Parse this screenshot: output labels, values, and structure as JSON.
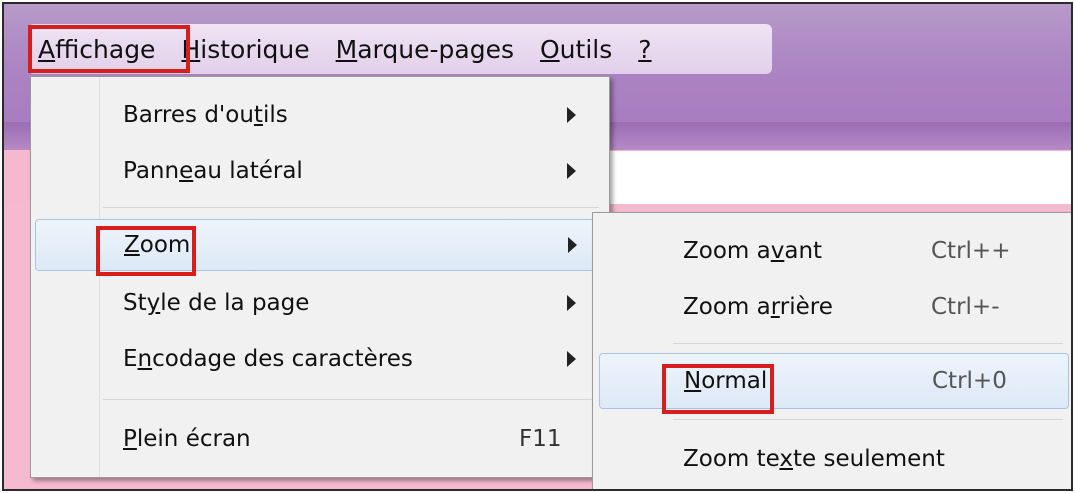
{
  "menubar": {
    "items": [
      {
        "accel": "A",
        "rest": "ffichage"
      },
      {
        "accel": "H",
        "rest": "istorique"
      },
      {
        "accel": "M",
        "rest": "arque-pages"
      },
      {
        "accel": "O",
        "rest": "utils"
      },
      {
        "accel": "?",
        "rest": ""
      }
    ]
  },
  "view_menu": {
    "items": [
      {
        "pre": "Barres d'ou",
        "accel": "t",
        "post": "ils",
        "submenu": true
      },
      {
        "pre": "Pann",
        "accel": "e",
        "post": "au latéral",
        "submenu": true
      },
      {
        "pre": "",
        "accel": "Z",
        "post": "oom",
        "submenu": true,
        "highlighted": true
      },
      {
        "pre": "St",
        "accel": "y",
        "post": "le de la page",
        "submenu": true
      },
      {
        "pre": "E",
        "accel": "n",
        "post": "codage des caractères",
        "submenu": true
      },
      {
        "pre": "",
        "accel": "P",
        "post": "lein écran",
        "shortcut": "F11"
      }
    ]
  },
  "zoom_submenu": {
    "items": [
      {
        "pre": "Zoom a",
        "accel": "v",
        "post": "ant",
        "shortcut": "Ctrl++"
      },
      {
        "pre": "Zoom a",
        "accel": "r",
        "post": "rière",
        "shortcut": "Ctrl+-"
      },
      {
        "pre": "",
        "accel": "N",
        "post": "ormal",
        "shortcut": "Ctrl+0",
        "highlighted": true
      },
      {
        "pre": "Zoom te",
        "accel": "x",
        "post": "te seulement",
        "shortcut": ""
      }
    ]
  },
  "annotation_color": "#d81d1d",
  "highlight_color": "#dde9f7"
}
